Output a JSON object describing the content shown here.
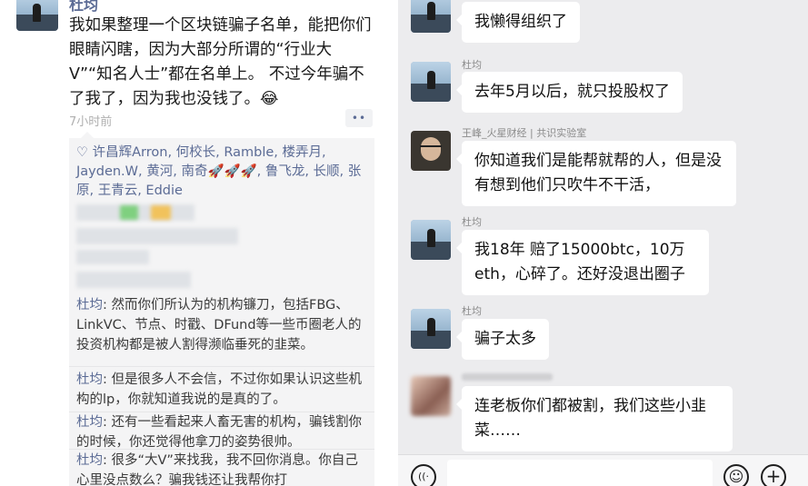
{
  "post": {
    "author": "杜均",
    "text": "我如果整理一个区块链骗子名单，能把你们眼睛闪瞎，因为大部分所谓的“行业大V”“知名人士”都在名单上。 不过今年骗不了我了，因为我也没钱了。😂",
    "time": "7小时前",
    "more": "••",
    "likes_icon": "♡",
    "likes": "许昌辉Arron, 何校长, Ramble, 楼弄月, Jayden.W, 黄河, 南奇🚀🚀🚀, 鲁飞龙, 长顺, 张原, 王青云, Eddie",
    "comments": [
      {
        "who": "杜均",
        "text": ": 然而你们所认为的机构镰刀，包括FBG、LinkVC、节点、时戳、DFund等一些币圈老人的投资机构都是被人割得濒临垂死的韭菜。"
      },
      {
        "who": "杜均",
        "text": ": 但是很多人不会信，不过你如果认识这些机构的lp，你就知道我说的是真的了。"
      },
      {
        "who": "杜均",
        "text": ": 还有一些看起来人畜无害的机构，骗钱割你的时候，你还觉得他拿刀的姿势很帅。"
      },
      {
        "who": "杜均",
        "text": ": 很多“大V”来找我，我不回你消息。你自己心里没点数么？骗我钱还让我帮你打"
      }
    ]
  },
  "chat": {
    "messages": [
      {
        "sender": "",
        "text": "我懒得组织了"
      },
      {
        "sender": "杜均",
        "text": "去年5月以后，就只投股权了"
      },
      {
        "sender": "王峰_火星财经 | 共识实验室",
        "text": "你知道我们是能帮就帮的人，但是没有想到他们只吹牛不干活，"
      },
      {
        "sender": "杜均",
        "text": "我18年 赔了15000btc，10万eth，心碎了。还好没退出圈子"
      },
      {
        "sender": "杜均",
        "text": "骗子太多"
      },
      {
        "sender": "",
        "text": "连老板你们都被割，我们这些小韭菜……"
      }
    ],
    "input_placeholder": "",
    "voice_icon": "((·",
    "emoji_icon": "☺",
    "plus_icon": "+"
  }
}
